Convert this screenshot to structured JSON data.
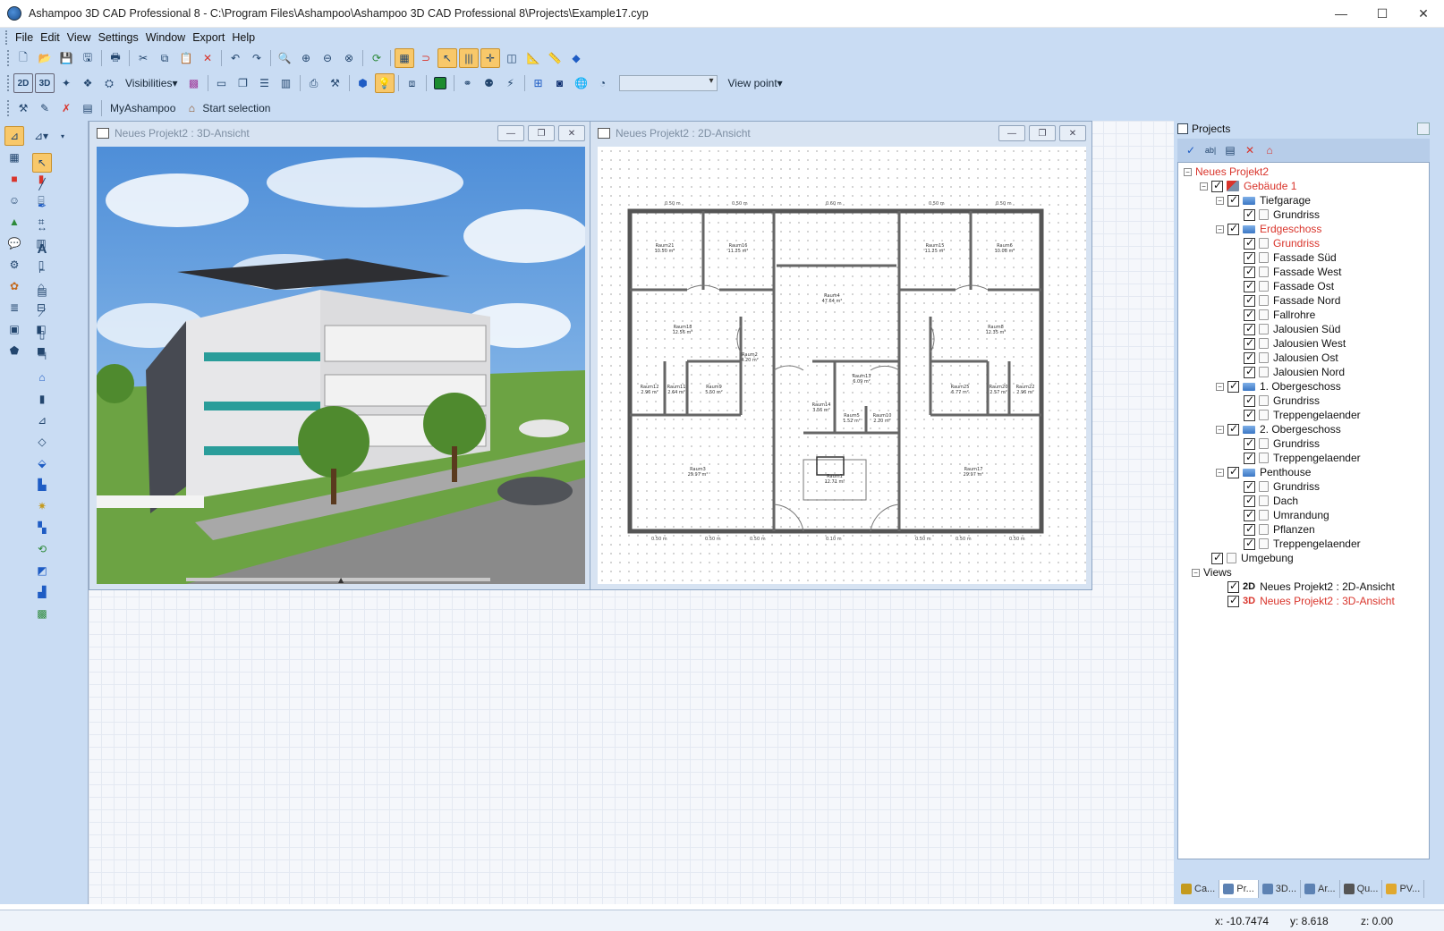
{
  "window": {
    "title": "Ashampoo 3D CAD Professional 8 - C:\\Program Files\\Ashampoo\\Ashampoo 3D CAD Professional 8\\Projects\\Example17.cyp",
    "minimize": "—",
    "maximize": "☐",
    "close": "✕"
  },
  "menu": [
    "File",
    "Edit",
    "View",
    "Settings",
    "Window",
    "Export",
    "Help"
  ],
  "toolbar2": {
    "btn_2d": "2D",
    "btn_3d": "3D",
    "visibilities": "Visibilities▾",
    "view_point": "View point▾",
    "combo_value": ""
  },
  "toolbar3": {
    "myashampoo": "MyAshampoo",
    "start_selection": "Start selection"
  },
  "views": {
    "view3d_title": "Neues Projekt2 : 3D-Ansicht",
    "view2d_title": "Neues Projekt2 : 2D-Ansicht"
  },
  "floorplan": {
    "dims_top": [
      "0.50 m",
      "0.50 m",
      "0.50 m",
      "0.60 m",
      "0.50 m",
      "0.50 m"
    ],
    "dims_bottom": [
      "0.50 m",
      "0.50 m",
      "0.50 m",
      "0.10 m",
      "0.50 m",
      "0.50 m",
      "0.50 m"
    ],
    "rooms": [
      {
        "name": "Raum21",
        "area": "10.50 m²"
      },
      {
        "name": "Raum16",
        "area": "11.25 m²"
      },
      {
        "name": "Raum15",
        "area": "11.25 m²"
      },
      {
        "name": "Raum6",
        "area": "10.08 m²"
      },
      {
        "name": "Raum4",
        "area": "47.64 m²"
      },
      {
        "name": "Raum18",
        "area": "12.56 m²"
      },
      {
        "name": "Raum8",
        "area": "12.35 m²"
      },
      {
        "name": "Raum2",
        "area": "4.20 m²"
      },
      {
        "name": "Raum13",
        "area": "6.09 m²"
      },
      {
        "name": "Raum12",
        "area": "2.96 m²"
      },
      {
        "name": "Raum11",
        "area": "2.64 m²"
      },
      {
        "name": "Raum9",
        "area": "5.50 m²"
      },
      {
        "name": "Raum25",
        "area": "6.77 m²"
      },
      {
        "name": "Raum20",
        "area": "2.57 m²"
      },
      {
        "name": "Raum22",
        "area": "2.96 m²"
      },
      {
        "name": "Raum14",
        "area": "3.56 m²"
      },
      {
        "name": "Raum5",
        "area": "1.52 m²"
      },
      {
        "name": "Raum10",
        "area": "2.20 m²"
      },
      {
        "name": "Raum3",
        "area": "29.97 m²"
      },
      {
        "name": "Raum1",
        "area": "12.71 m²"
      },
      {
        "name": "Raum17",
        "area": "29.97 m²"
      }
    ]
  },
  "projects": {
    "header": "Projects",
    "tree": [
      {
        "label": "Neues Projekt2",
        "level": 0,
        "expand": "−",
        "red": true,
        "check": false,
        "icon": "proj"
      },
      {
        "label": "Gebäude 1",
        "level": 1,
        "expand": "−",
        "red": true,
        "check": true,
        "icon": "bld"
      },
      {
        "label": "Tiefgarage",
        "level": 2,
        "expand": "−",
        "red": false,
        "check": true,
        "icon": "floor"
      },
      {
        "label": "Grundriss",
        "level": 3,
        "expand": "",
        "red": false,
        "check": true,
        "icon": "doc"
      },
      {
        "label": "Erdgeschoss",
        "level": 2,
        "expand": "−",
        "red": true,
        "check": true,
        "icon": "floor"
      },
      {
        "label": "Grundriss",
        "level": 3,
        "expand": "",
        "red": true,
        "check": true,
        "icon": "doc"
      },
      {
        "label": "Fassade Süd",
        "level": 3,
        "expand": "",
        "red": false,
        "check": true,
        "icon": "doc"
      },
      {
        "label": "Fassade West",
        "level": 3,
        "expand": "",
        "red": false,
        "check": true,
        "icon": "doc"
      },
      {
        "label": "Fassade Ost",
        "level": 3,
        "expand": "",
        "red": false,
        "check": true,
        "icon": "doc"
      },
      {
        "label": "Fassade Nord",
        "level": 3,
        "expand": "",
        "red": false,
        "check": true,
        "icon": "doc"
      },
      {
        "label": "Fallrohre",
        "level": 3,
        "expand": "",
        "red": false,
        "check": true,
        "icon": "doc"
      },
      {
        "label": "Jalousien Süd",
        "level": 3,
        "expand": "",
        "red": false,
        "check": true,
        "icon": "doc"
      },
      {
        "label": "Jalousien West",
        "level": 3,
        "expand": "",
        "red": false,
        "check": true,
        "icon": "doc"
      },
      {
        "label": "Jalousien Ost",
        "level": 3,
        "expand": "",
        "red": false,
        "check": true,
        "icon": "doc"
      },
      {
        "label": "Jalousien Nord",
        "level": 3,
        "expand": "",
        "red": false,
        "check": true,
        "icon": "doc"
      },
      {
        "label": "1. Obergeschoss",
        "level": 2,
        "expand": "−",
        "red": false,
        "check": true,
        "icon": "floor"
      },
      {
        "label": "Grundriss",
        "level": 3,
        "expand": "",
        "red": false,
        "check": true,
        "icon": "doc"
      },
      {
        "label": "Treppengelaender",
        "level": 3,
        "expand": "",
        "red": false,
        "check": true,
        "icon": "doc"
      },
      {
        "label": "2. Obergeschoss",
        "level": 2,
        "expand": "−",
        "red": false,
        "check": true,
        "icon": "floor"
      },
      {
        "label": "Grundriss",
        "level": 3,
        "expand": "",
        "red": false,
        "check": true,
        "icon": "doc"
      },
      {
        "label": "Treppengelaender",
        "level": 3,
        "expand": "",
        "red": false,
        "check": true,
        "icon": "doc"
      },
      {
        "label": "Penthouse",
        "level": 2,
        "expand": "−",
        "red": false,
        "check": true,
        "icon": "floor"
      },
      {
        "label": "Grundriss",
        "level": 3,
        "expand": "",
        "red": false,
        "check": true,
        "icon": "doc"
      },
      {
        "label": "Dach",
        "level": 3,
        "expand": "",
        "red": false,
        "check": true,
        "icon": "doc"
      },
      {
        "label": "Umrandung",
        "level": 3,
        "expand": "",
        "red": false,
        "check": true,
        "icon": "doc"
      },
      {
        "label": "Pflanzen",
        "level": 3,
        "expand": "",
        "red": false,
        "check": true,
        "icon": "doc"
      },
      {
        "label": "Treppengelaender",
        "level": 3,
        "expand": "",
        "red": false,
        "check": true,
        "icon": "doc"
      },
      {
        "label": "Umgebung",
        "level": 1,
        "expand": "",
        "red": false,
        "check": true,
        "icon": "doc"
      },
      {
        "label": "Views",
        "level": 0.5,
        "expand": "−",
        "red": false,
        "check": false,
        "icon": "proj"
      },
      {
        "label": "Neues Projekt2 : 2D-Ansicht",
        "level": 2,
        "expand": "",
        "red": false,
        "check": true,
        "icon": "proj",
        "tag": "2D"
      },
      {
        "label": "Neues Projekt2 : 3D-Ansicht",
        "level": 2,
        "expand": "",
        "red": true,
        "check": true,
        "icon": "proj",
        "tag": "3D"
      }
    ],
    "tabs": [
      "Ca...",
      "Pr...",
      "3D...",
      "Ar...",
      "Qu...",
      "PV..."
    ]
  },
  "status": {
    "x": "x: -10.7474",
    "y": "y: 8.618",
    "z": "z: 0.00"
  },
  "colors": {
    "accent_red": "#d9342b",
    "toolbar_band": "#c9dcf3",
    "active_tool": "#f8c86a"
  }
}
